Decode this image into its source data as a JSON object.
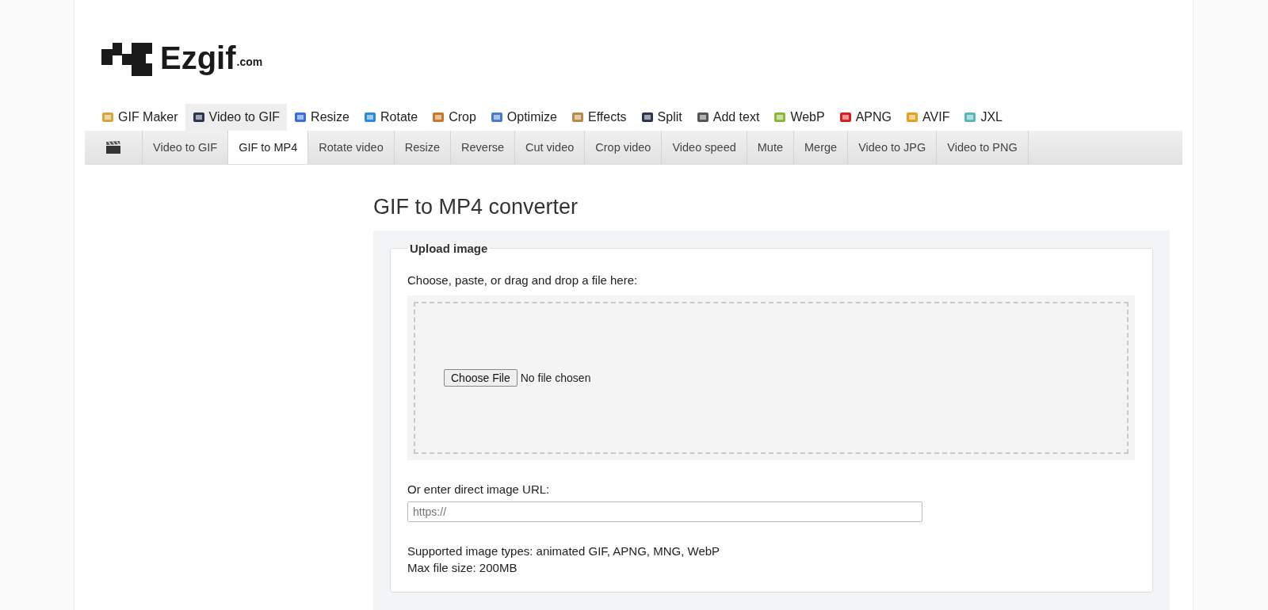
{
  "logo": {
    "name": "Ezgif",
    "suffix": ".com"
  },
  "main_tabs": [
    {
      "label": "GIF Maker",
      "selected": false
    },
    {
      "label": "Video to GIF",
      "selected": true
    },
    {
      "label": "Resize",
      "selected": false
    },
    {
      "label": "Rotate",
      "selected": false
    },
    {
      "label": "Crop",
      "selected": false
    },
    {
      "label": "Optimize",
      "selected": false
    },
    {
      "label": "Effects",
      "selected": false
    },
    {
      "label": "Split",
      "selected": false
    },
    {
      "label": "Add text",
      "selected": false
    },
    {
      "label": "WebP",
      "selected": false
    },
    {
      "label": "APNG",
      "selected": false
    },
    {
      "label": "AVIF",
      "selected": false
    },
    {
      "label": "JXL",
      "selected": false
    }
  ],
  "sub_tabs": [
    {
      "label": "Video to GIF",
      "selected": false
    },
    {
      "label": "GIF to MP4",
      "selected": true
    },
    {
      "label": "Rotate video",
      "selected": false
    },
    {
      "label": "Resize",
      "selected": false
    },
    {
      "label": "Reverse",
      "selected": false
    },
    {
      "label": "Cut video",
      "selected": false
    },
    {
      "label": "Crop video",
      "selected": false
    },
    {
      "label": "Video speed",
      "selected": false
    },
    {
      "label": "Mute",
      "selected": false
    },
    {
      "label": "Merge",
      "selected": false
    },
    {
      "label": "Video to JPG",
      "selected": false
    },
    {
      "label": "Video to PNG",
      "selected": false
    }
  ],
  "page_title": "GIF to MP4 converter",
  "upload": {
    "legend": "Upload image",
    "prompt": "Choose, paste, or drag and drop a file here:",
    "file_button": "Choose File",
    "file_status": "No file chosen",
    "url_label": "Or enter direct image URL:",
    "url_placeholder": "https://",
    "supported": "Supported image types: animated GIF, APNG, MNG, WebP",
    "max_size": "Max file size: 200MB"
  }
}
